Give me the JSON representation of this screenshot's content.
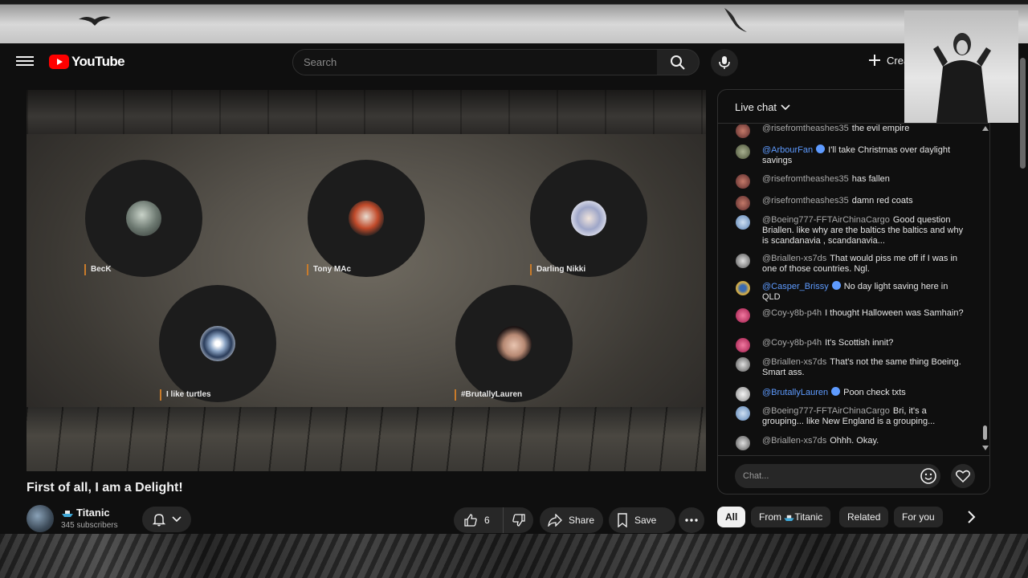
{
  "header": {
    "logo_text": "YouTube",
    "search_placeholder": "Search",
    "create_label": "Create"
  },
  "video": {
    "title": "First of all, I am a Delight!",
    "participants": [
      {
        "label": "BecK"
      },
      {
        "label": "Tony MAc"
      },
      {
        "label": "Darling Nikki"
      },
      {
        "label": "I like turtles"
      },
      {
        "label": "#BrutallyLauren"
      }
    ]
  },
  "channel": {
    "name": "Titanic",
    "subscribers": "345 subscribers"
  },
  "actions": {
    "like_count": "6",
    "share_label": "Share",
    "save_label": "Save"
  },
  "chat": {
    "title": "Live chat",
    "input_placeholder": "Chat...",
    "messages": [
      {
        "author": "@risefromtheashes35",
        "text": "the evil empire",
        "verified": false,
        "avatar_color": "#8a3a3a"
      },
      {
        "author": "@ArbourFan",
        "text": "I'll take Christmas over daylight savings",
        "verified": true,
        "avatar_color": "#6b7a55"
      },
      {
        "author": "@risefromtheashes35",
        "text": "has fallen",
        "verified": false,
        "avatar_color": "#8a3a3a"
      },
      {
        "author": "@risefromtheashes35",
        "text": "damn red coats",
        "verified": false,
        "avatar_color": "#8a3a3a"
      },
      {
        "author": "@Boeing777-FFTAirChinaCargo",
        "text": "Good question Briallen. like why are the baltics the baltics and why is scandanavia , scandanavia...",
        "verified": false,
        "avatar_color": "#7aa4d6"
      },
      {
        "author": "@Briallen-xs7ds",
        "text": "That would piss me off if I was in one of those countries. Ngl.",
        "verified": false,
        "avatar_color": "#9a9a9a"
      },
      {
        "author": "@Casper_Brissy",
        "text": "No day light saving here in QLD",
        "verified": true,
        "avatar_color": "#c9a24a"
      },
      {
        "author": "@Coy-y8b-p4h",
        "text": "I thought Halloween was Samhain?",
        "verified": false,
        "avatar_color": "#d4386a"
      },
      {
        "author": "@Coy-y8b-p4h",
        "text": "It's Scottish innit?",
        "verified": false,
        "avatar_color": "#d4386a"
      },
      {
        "author": "@Briallen-xs7ds",
        "text": "That's not the same thing Boeing. Smart ass.",
        "verified": false,
        "avatar_color": "#9a9a9a"
      },
      {
        "author": "@BrutallyLauren",
        "text": "Poon check txts",
        "verified": true,
        "avatar_color": "#cfcfcf"
      },
      {
        "author": "@Boeing777-FFTAirChinaCargo",
        "text": "Bri, it's a grouping... like New England is a grouping...",
        "verified": false,
        "avatar_color": "#7aa4d6"
      },
      {
        "author": "@Briallen-xs7ds",
        "text": "Ohhh. Okay.",
        "verified": false,
        "avatar_color": "#9a9a9a"
      }
    ]
  },
  "chips": [
    {
      "label": "All",
      "active": true
    },
    {
      "label": "From Titanic",
      "active": false
    },
    {
      "label": "Related",
      "active": false
    },
    {
      "label": "For you",
      "active": false
    }
  ]
}
